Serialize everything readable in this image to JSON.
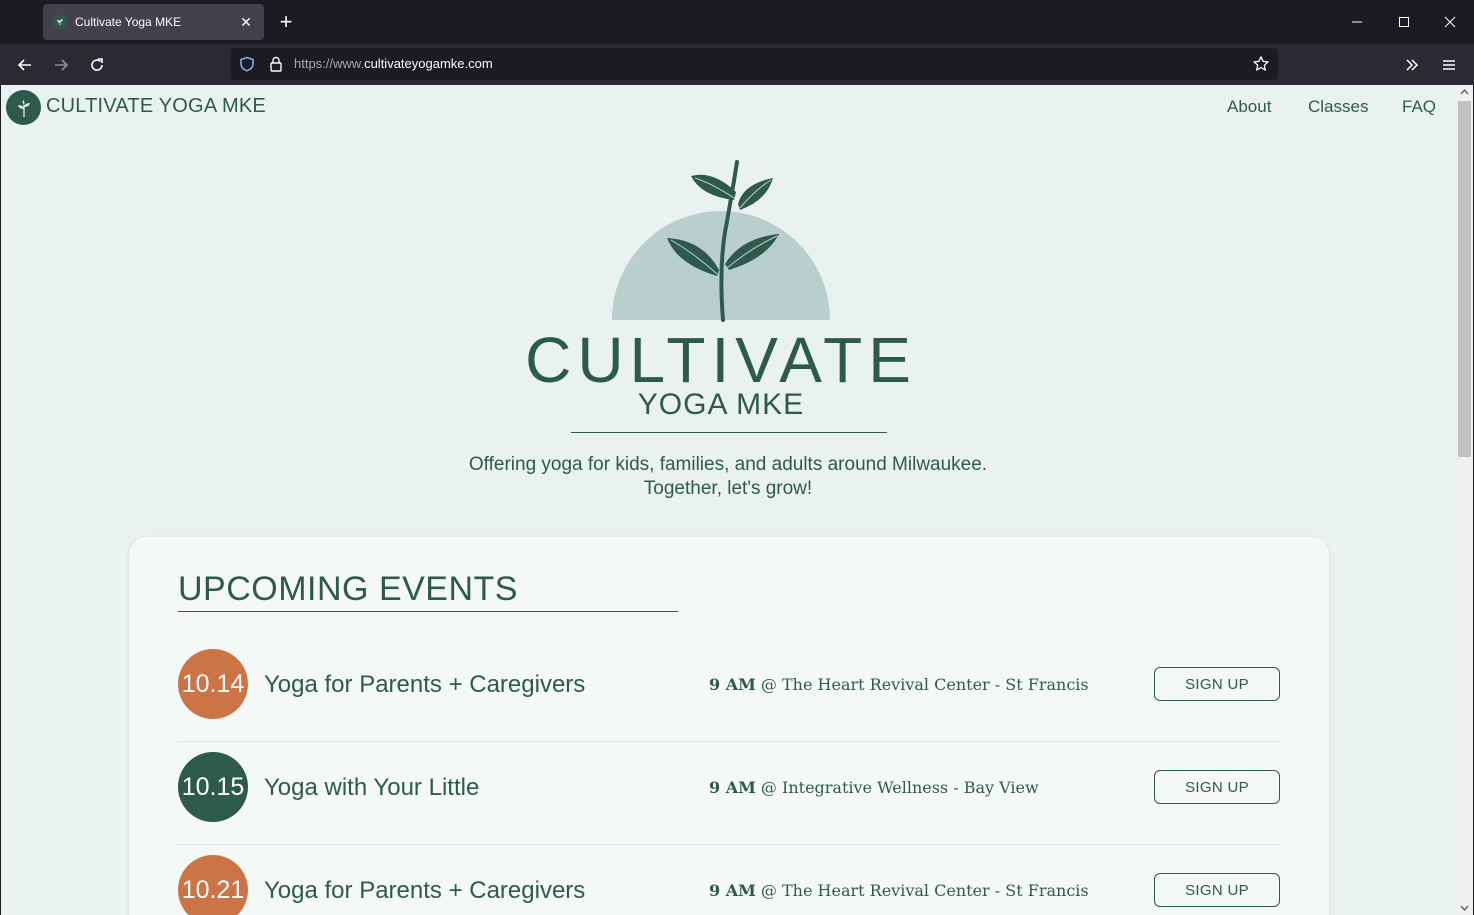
{
  "browser": {
    "tab_title": "Cultivate Yoga MKE",
    "tab_close": "✕",
    "new_tab": "+",
    "url_prefix": "https://www.",
    "url_domain": "cultivateyogamke.com"
  },
  "site": {
    "name": "CULTIVATE YOGA MKE",
    "nav": [
      "About",
      "Classes",
      "FAQ"
    ]
  },
  "hero": {
    "title": "CULTIVATE",
    "subtitle": "YOGA MKE",
    "tagline_line1": "Offering yoga for kids, families, and adults around Milwaukee.",
    "tagline_line2": "Together, let's grow!"
  },
  "events": {
    "heading": "UPCOMING EVENTS",
    "items": [
      {
        "date": "10.14",
        "title": "Yoga for Parents + Caregivers",
        "time": "9 AM",
        "location": "@ The Heart Revival Center - St Francis",
        "button": "SIGN UP",
        "color": "#cd7447"
      },
      {
        "date": "10.15",
        "title": "Yoga with Your Little",
        "time": "9 AM",
        "location": "@ Integrative Wellness - Bay View",
        "button": "SIGN UP",
        "color": "#2e5a4e"
      },
      {
        "date": "10.21",
        "title": "Yoga for Parents + Caregivers",
        "time": "9 AM",
        "location": "@ The Heart Revival Center - St Francis",
        "button": "SIGN UP",
        "color": "#cd7447"
      }
    ]
  },
  "colors": {
    "brand_green": "#2e5a4e",
    "accent_orange": "#cd7447",
    "page_bg": "#eaf2f0",
    "hill": "#b9cfcb"
  }
}
